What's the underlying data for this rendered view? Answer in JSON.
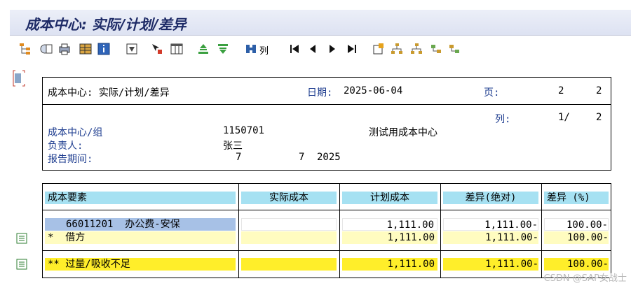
{
  "window": {
    "title": "成本中心: 实际/计划/差异"
  },
  "toolbar": {
    "columns_label": "列"
  },
  "report_header": {
    "title": "成本中心: 实际/计划/差异",
    "date_label": "日期:",
    "date_value": "2025-06-04",
    "page_label": "页:",
    "page_current": "2",
    "page_total": "2",
    "column_label": "列:",
    "column_current": "1/",
    "column_total": "2",
    "cost_center_label": "成本中心/组",
    "cost_center_value": "1150701",
    "cost_center_desc": "测试用成本中心",
    "responsible_label": "负责人:",
    "responsible_value": "张三",
    "period_label": "报告期间:",
    "period_from": "7",
    "period_to": "7",
    "period_year": "2025"
  },
  "table": {
    "headers": [
      "成本要素",
      "实际成本",
      "计划成本",
      "差异(绝对)",
      "差异 (%)"
    ],
    "rows": [
      {
        "element": "66011201  办公费-安保",
        "actual": "",
        "plan": "1,111.00",
        "var_abs": "1,111.00-",
        "var_pct": "100.00-"
      },
      {
        "element": "*  借方",
        "actual": "",
        "plan": "1,111.00",
        "var_abs": "1,111.00-",
        "var_pct": "100.00-"
      },
      {
        "element": "** 过量/吸收不足",
        "actual": "",
        "plan": "1,111.00",
        "var_abs": "1,111.00-",
        "var_pct": "100.00-"
      }
    ]
  },
  "watermark": "CSDN @SAP女战士"
}
